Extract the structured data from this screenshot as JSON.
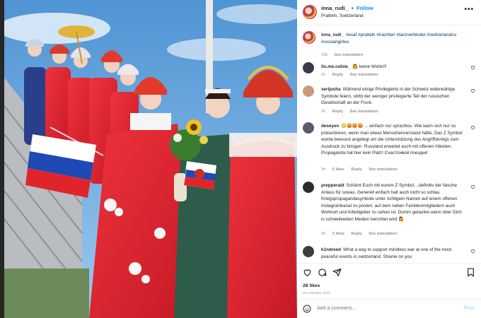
{
  "header": {
    "username": "inna_rudi_",
    "separator": "•",
    "follow_label": "Follow",
    "location": "Pratteln, Switzerland"
  },
  "caption": {
    "username": "inna_rudi_",
    "text": "#esaf #pratteln #trachten #tanzverbindet #switzerlandсн #russiangirleu",
    "time": "16h",
    "see_translation": "See translation"
  },
  "comments": [
    {
      "username": "its.me.celine_",
      "text": "🙆 keine Worte!!!",
      "time": "2h",
      "reply": "Reply",
      "see_translation": "See translation"
    },
    {
      "username": "serijosha",
      "text": "Während einige Privilegierte in der Schweiz widerwärtige Symbole feiern, stirbt der weniger privilegierte Teil der russischen Gesellschaft an der Front.",
      "time": "2h",
      "reply": "Reply",
      "see_translation": "See translation"
    },
    {
      "username": "deseyen",
      "text": "😳😡😡😡 ... einfach nur sprachlos. Wie kann sich nur so präsentieren, wenn man etwas Menschenverstand hätte. Das Z Symbol wurde bewusst angelegt um die Unterstützung des Angriffskriegs zum Ausdruck zu bringen. Russland erwartet euch mit offenen Händen. Propaganda hat hier kein Platz! Счастливой поездки!",
      "time": "2h",
      "likes": "2 likes",
      "reply": "Reply",
      "see_translation": "See translation"
    },
    {
      "username": "prepperaid",
      "text": "Schämt Euch mit eurem Z Symbol....definitiv der falsche Anlass für sowas. Generell einfach halt auch nicht so schlau Kriegspropagandasymbole unter richtigem Namen auf einem offenen Instagramkanal zu posten, auf dem neben Familienmitgliedern auch Wohnort und Arbeitgeber zu sehen ist. Dumm gelaufen wenn über Dich in schweitweiten Medien berichtet wird 🤷",
      "time": "2h",
      "likes": "2 likes",
      "reply": "Reply",
      "see_translation": "See translation"
    },
    {
      "username": "k1ndreed",
      "text": "What a way to support mindless war at one of the most peaceful events in switzerland. Shame on you"
    }
  ],
  "footer": {
    "likes": "28 likes",
    "time_ago": "16 HOURS AGO",
    "comment_placeholder": "Add a comment...",
    "post_label": "Post"
  },
  "icons": {
    "like": "heart-icon",
    "comment": "comment-icon",
    "share": "share-icon",
    "save": "bookmark-icon",
    "emoji": "smiley-icon",
    "more": "more-options-icon"
  },
  "colors": {
    "link": "#0095f6",
    "hashtag": "#00376b",
    "muted": "#8e8e8e",
    "text": "#262626",
    "post_disabled": "#b3dbff"
  }
}
